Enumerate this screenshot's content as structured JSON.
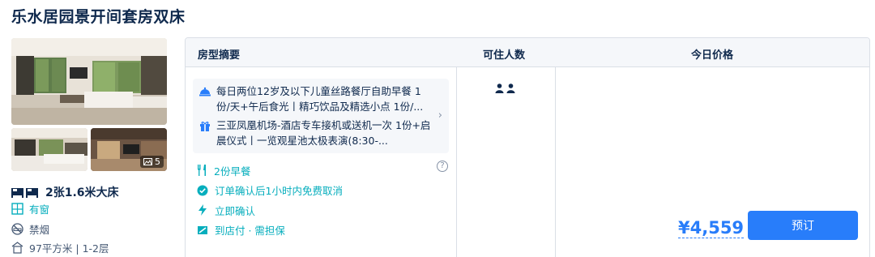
{
  "room": {
    "title": "乐水居园景开间套房双床",
    "photo_count": "5",
    "bed": "2张1.6米大床",
    "window": "有窗",
    "smoking": "禁烟",
    "area": "97平方米 | 1-2层"
  },
  "table": {
    "col_summary": "房型摘要",
    "col_guests": "可住人数",
    "col_price": "今日价格"
  },
  "perks": [
    {
      "icon": "dining-bell-icon",
      "text": "每日两位12岁及以下儿童丝路餐厅自助早餐 1份/天+午后食光丨精巧饮品及精选小点 1份/..."
    },
    {
      "icon": "gift-icon",
      "text": "三亚凤凰机场-酒店专车接机或送机一次 1份+启晨仪式丨一览观星池太极表演(8:30-..."
    }
  ],
  "policies": [
    {
      "icon": "fork-knife-icon",
      "text": "2份早餐"
    },
    {
      "icon": "check-circle-icon",
      "text": "订单确认后1小时内免费取消"
    },
    {
      "icon": "lightning-icon",
      "text": "立即确认"
    },
    {
      "icon": "payment-icon",
      "text": "到店付 · 需担保"
    }
  ],
  "guests": {
    "count": 2
  },
  "price": {
    "amount": "¥4,559",
    "book_label": "预订"
  },
  "colors": {
    "accent": "#287dfa",
    "green": "#06aebd",
    "text": "#0f294d"
  }
}
